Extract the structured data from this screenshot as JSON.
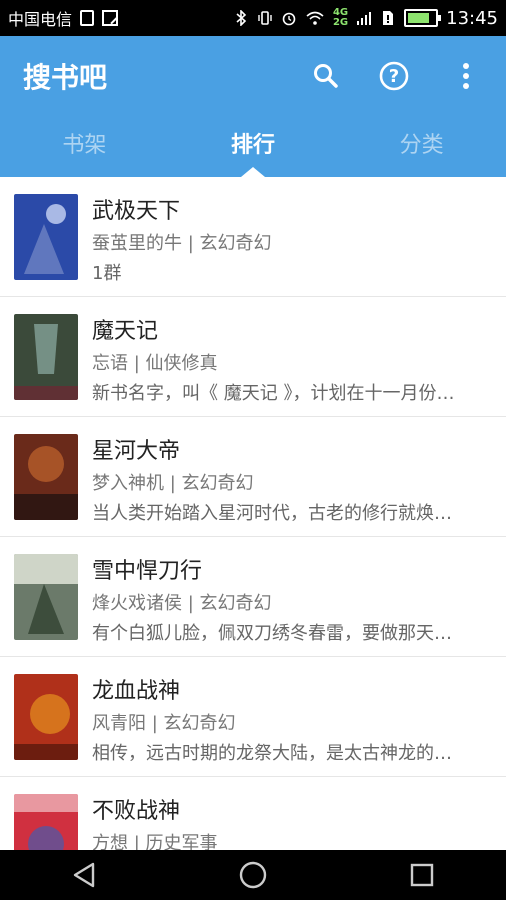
{
  "status_bar": {
    "carrier": "中国电信",
    "network_top": "4G",
    "network_bottom": "2G",
    "battery_level": 0.8,
    "time": "13:45"
  },
  "app": {
    "title": "搜书吧",
    "actions": [
      "search-icon",
      "help-icon",
      "more-vert-icon"
    ],
    "accent_color": "#4aa0e3"
  },
  "tabs": [
    {
      "label": "书架",
      "active": false
    },
    {
      "label": "排行",
      "active": true
    },
    {
      "label": "分类",
      "active": false
    }
  ],
  "books": [
    {
      "title": "武极天下",
      "meta": "蚕茧里的牛 | 玄幻奇幻",
      "desc": "1群",
      "cover_color": "#2b4aa8"
    },
    {
      "title": "魔天记",
      "meta": "忘语 | 仙侠修真",
      "desc": "新书名字，叫《 魔天记 》，计划在十一月份…",
      "cover_color": "#3b4a3a"
    },
    {
      "title": "星河大帝",
      "meta": "梦入神机 | 玄幻奇幻",
      "desc": "当人类开始踏入星河时代，古老的修行就焕…",
      "cover_color": "#6a2a1a"
    },
    {
      "title": "雪中悍刀行",
      "meta": "烽火戏诸侯 | 玄幻奇幻",
      "desc": "有个白狐儿脸，佩双刀绣冬春雷，要做那天…",
      "cover_color": "#6b7a6a"
    },
    {
      "title": "龙血战神",
      "meta": "风青阳 | 玄幻奇幻",
      "desc": "相传，远古时期的龙祭大陆，是太古神龙的…",
      "cover_color": "#b0301a"
    },
    {
      "title": "不败战神",
      "meta": "方想 | 历史军事",
      "desc": "",
      "cover_color": "#d03040"
    }
  ],
  "nav": [
    "back-icon",
    "home-icon",
    "recents-icon"
  ]
}
